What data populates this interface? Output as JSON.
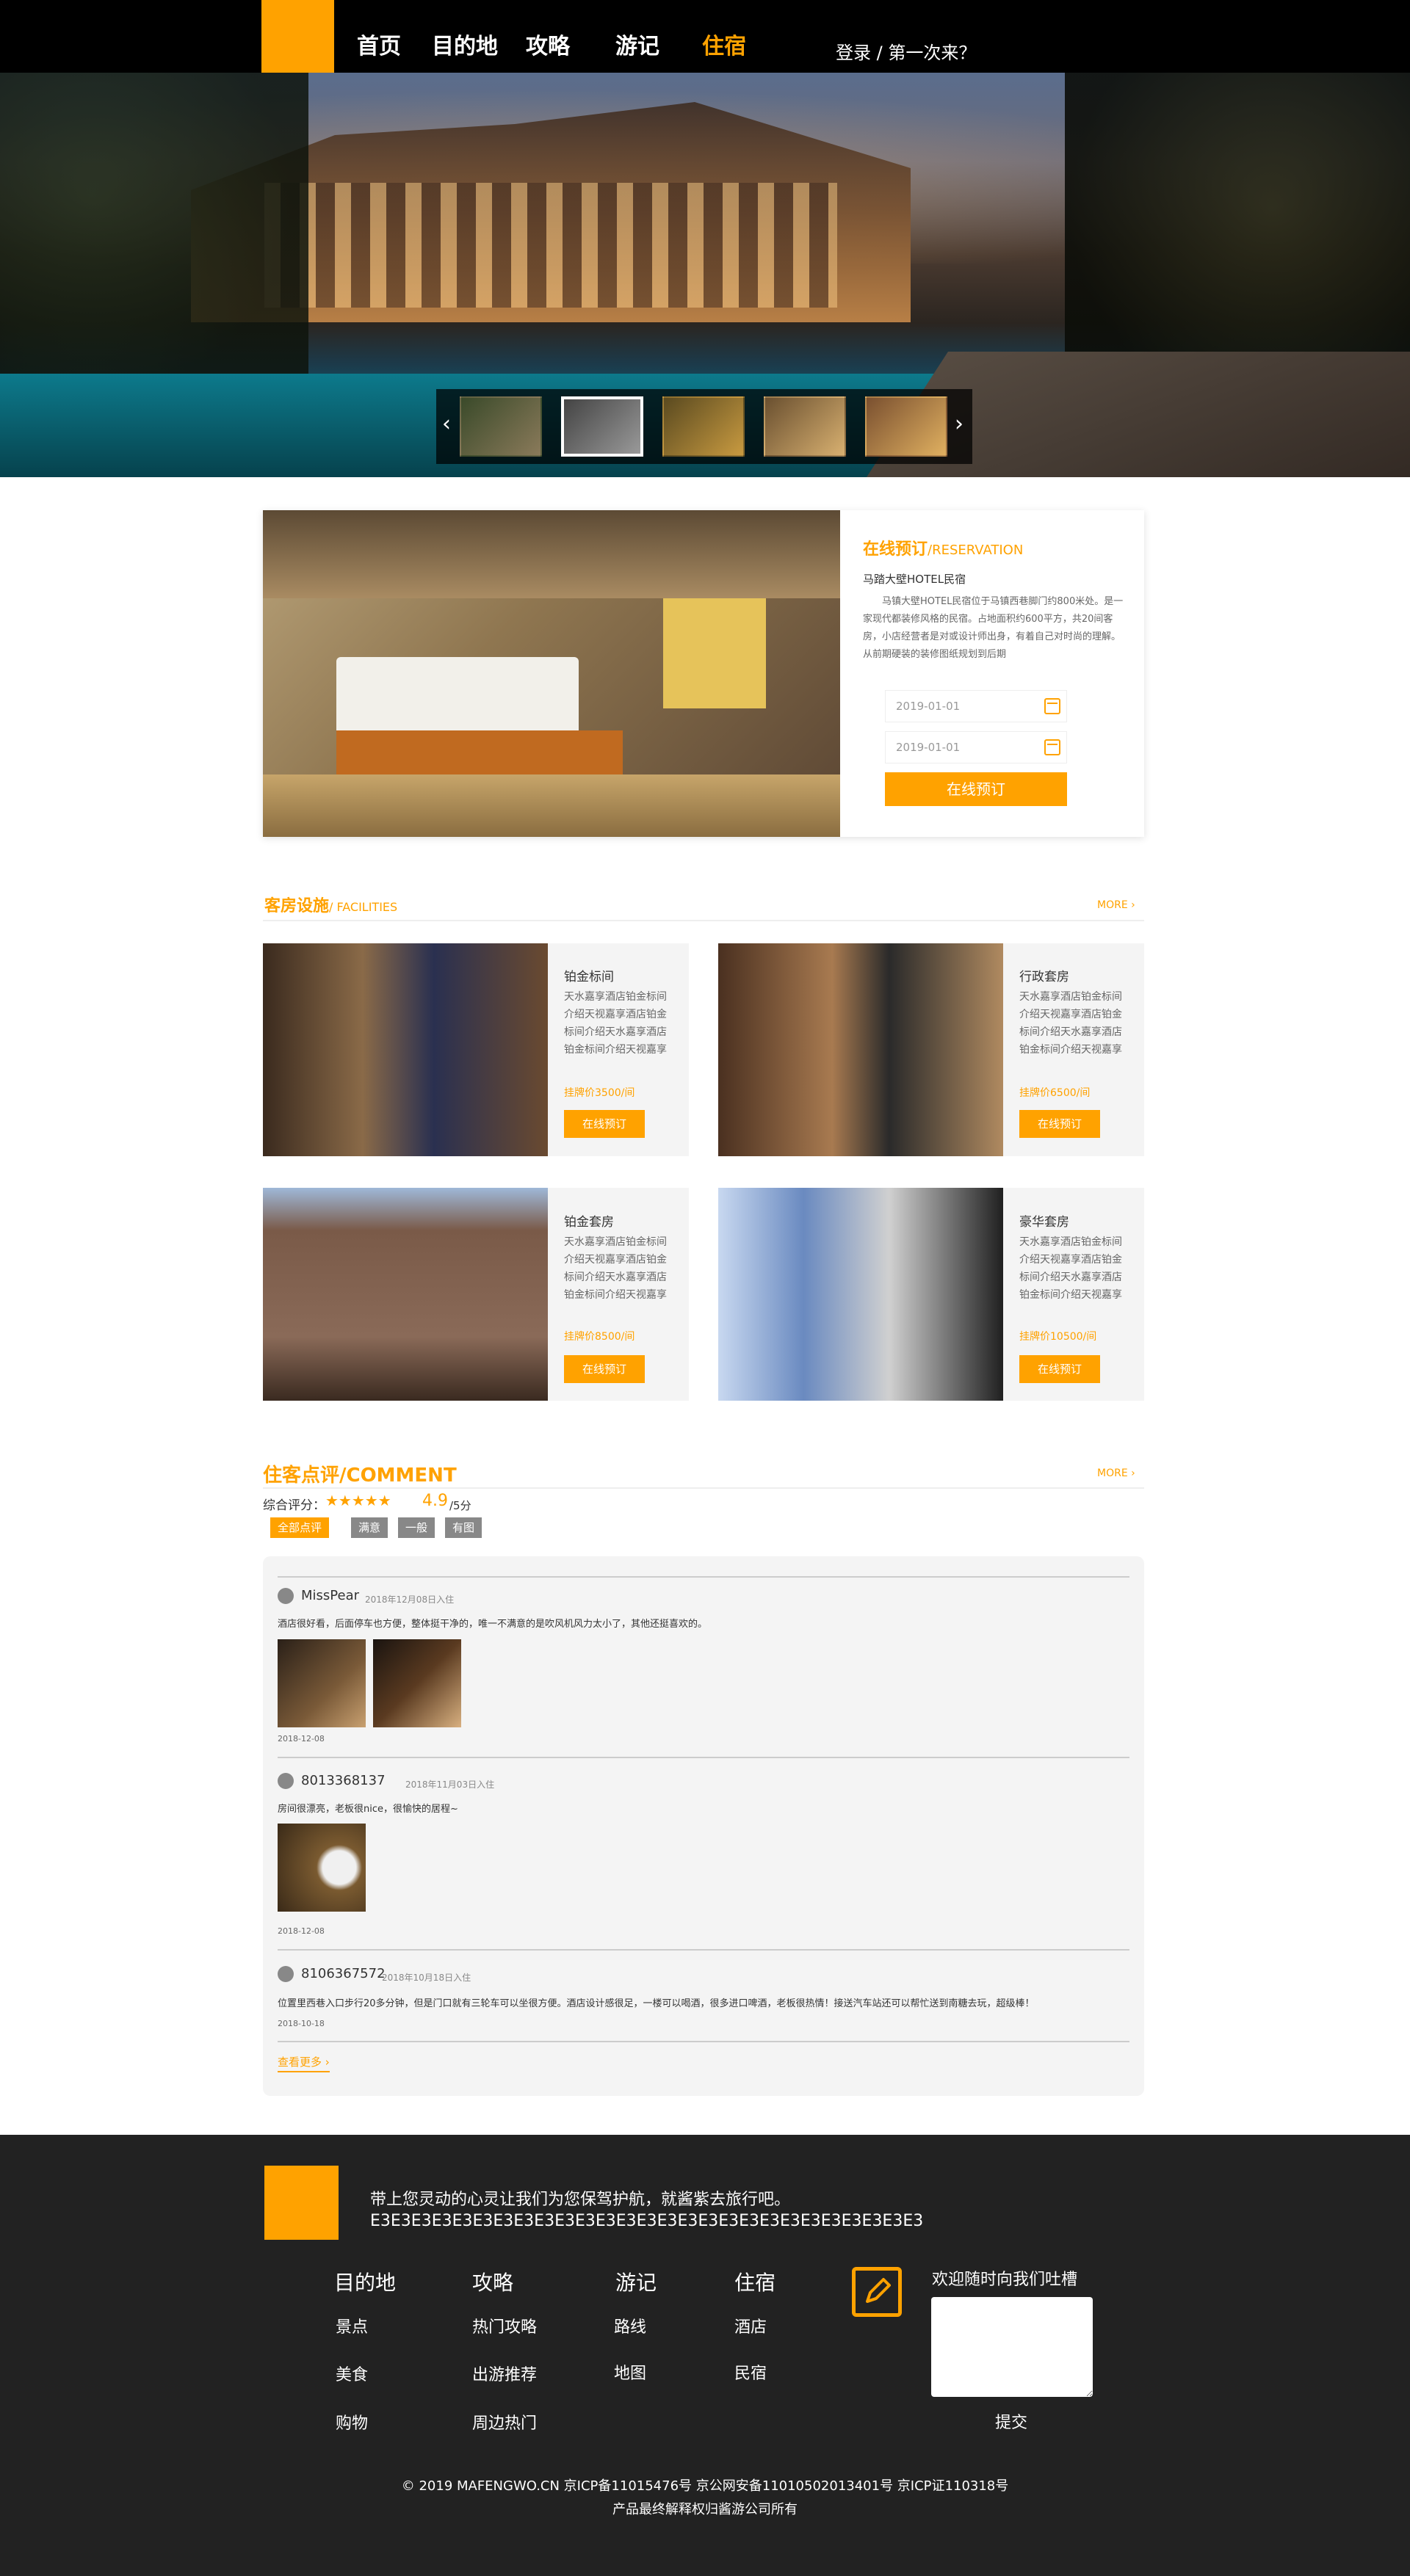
{
  "nav": {
    "items": [
      "首页",
      "目的地",
      "攻略",
      "游记",
      "住宿"
    ],
    "active": "住宿",
    "login": "登录 / 第一次来？"
  },
  "hero": {
    "thumbnails": 5,
    "active_thumbnail": 2,
    "prev_icon": "chevron-left-icon",
    "next_icon": "chevron-right-icon"
  },
  "reservation": {
    "title": "在线预订",
    "title_en": "/RESERVATION",
    "hotel_name": "马踏大壁HOTEL民宿",
    "description": "马镇大壁HOTEL民宿位于马镇西巷脚门约800米处。是一家现代都装修风格的民宿。占地面积约600平方，共20间客房，小店经营者是对或设计师出身，有着自己对时尚的理解。从前期硬装的装修图纸规划到后期",
    "checkin_placeholder": "2019-01-01",
    "checkout_placeholder": "2019-01-01",
    "book_label": "在线预订"
  },
  "facilities": {
    "title": "客房设施",
    "title_en": "/ FACILITIES",
    "more": "MORE ›",
    "rooms": [
      {
        "name": "铂金标间",
        "desc": "天水嘉享酒店铂金标间介绍天视嘉享酒店铂金标间介绍天水嘉享酒店铂金标间介绍天视嘉享酒店",
        "price": "挂牌价3500/间",
        "button": "在线预订"
      },
      {
        "name": "行政套房",
        "desc": "天水嘉享酒店铂金标间介绍天视嘉享酒店铂金标间介绍天水嘉享酒店铂金标间介绍天视嘉享酒店",
        "price": "挂牌价6500/间",
        "button": "在线预订"
      },
      {
        "name": "铂金套房",
        "desc": "天水嘉享酒店铂金标间介绍天视嘉享酒店铂金标间介绍天水嘉享酒店铂金标间介绍天视嘉享酒店",
        "price": "挂牌价8500/间",
        "button": "在线预订"
      },
      {
        "name": "豪华套房",
        "desc": "天水嘉享酒店铂金标间介绍天视嘉享酒店铂金标间介绍天水嘉享酒店铂金标间介绍天视嘉享酒店",
        "price": "挂牌价10500/间",
        "button": "在线预订"
      }
    ]
  },
  "comments": {
    "title": "住客点评/COMMENT",
    "more": "MORE ›",
    "rating_label": "综合评分：",
    "stars": "★★★★★",
    "score": "4.9",
    "score_unit": "/5分",
    "filters": [
      "全部点评",
      "满意",
      "一般",
      "有图"
    ],
    "items": [
      {
        "user": "MissPear",
        "stay": "2018年12月08日入住",
        "text": "酒店很好看，后面停车也方便，整体挺干净的，唯一不满意的是吹风机风力太小了，其他还挺喜欢的。",
        "date": "2018-12-08"
      },
      {
        "user": "8013368137",
        "stay": "2018年11月03日入住",
        "text": "房间很漂亮，老板很nice，很愉快的居程~",
        "date": "2018-12-08"
      },
      {
        "user": "8106367572",
        "stay": "2018年10月18日入住",
        "text": "位置里西巷入口步行20多分钟，但是门口就有三轮车可以坐很方便。酒店设计感很足，一楼可以喝酒，很多进口啤酒，老板很热情！接送汽车站还可以帮忙送到南糖去玩，超级棒！",
        "date": "2018-10-18"
      }
    ],
    "see_more": "查看更多 ›"
  },
  "footer": {
    "slogan": "带上您灵动的心灵让我们为您保驾护航，就酱紫去旅行吧。",
    "code": "E3E3E3E3E3E3E3E3E3E3E3E3E3E3E3E3E3E3E3E3E3E3E3E3E3E3E3",
    "columns": [
      {
        "title": "目的地",
        "links": [
          "景点",
          "美食",
          "购物"
        ]
      },
      {
        "title": "攻略",
        "links": [
          "热门攻略",
          "出游推荐",
          "周边热门"
        ]
      },
      {
        "title": "游记",
        "links": [
          "路线",
          "地图"
        ]
      },
      {
        "title": "住宿",
        "links": [
          "酒店",
          "民宿"
        ]
      }
    ],
    "feedback_title": "欢迎随时向我们吐槽",
    "submit": "提交",
    "copyright": "© 2019 MAFENGWO.CN 京ICP备11015476号 京公网安备11010502013401号 京ICP证110318号",
    "rights": "产品最终解释权归酱游公司所有"
  },
  "colors": {
    "accent": "#ffa200",
    "nav_bg": "#000000",
    "footer_bg": "#222222"
  }
}
